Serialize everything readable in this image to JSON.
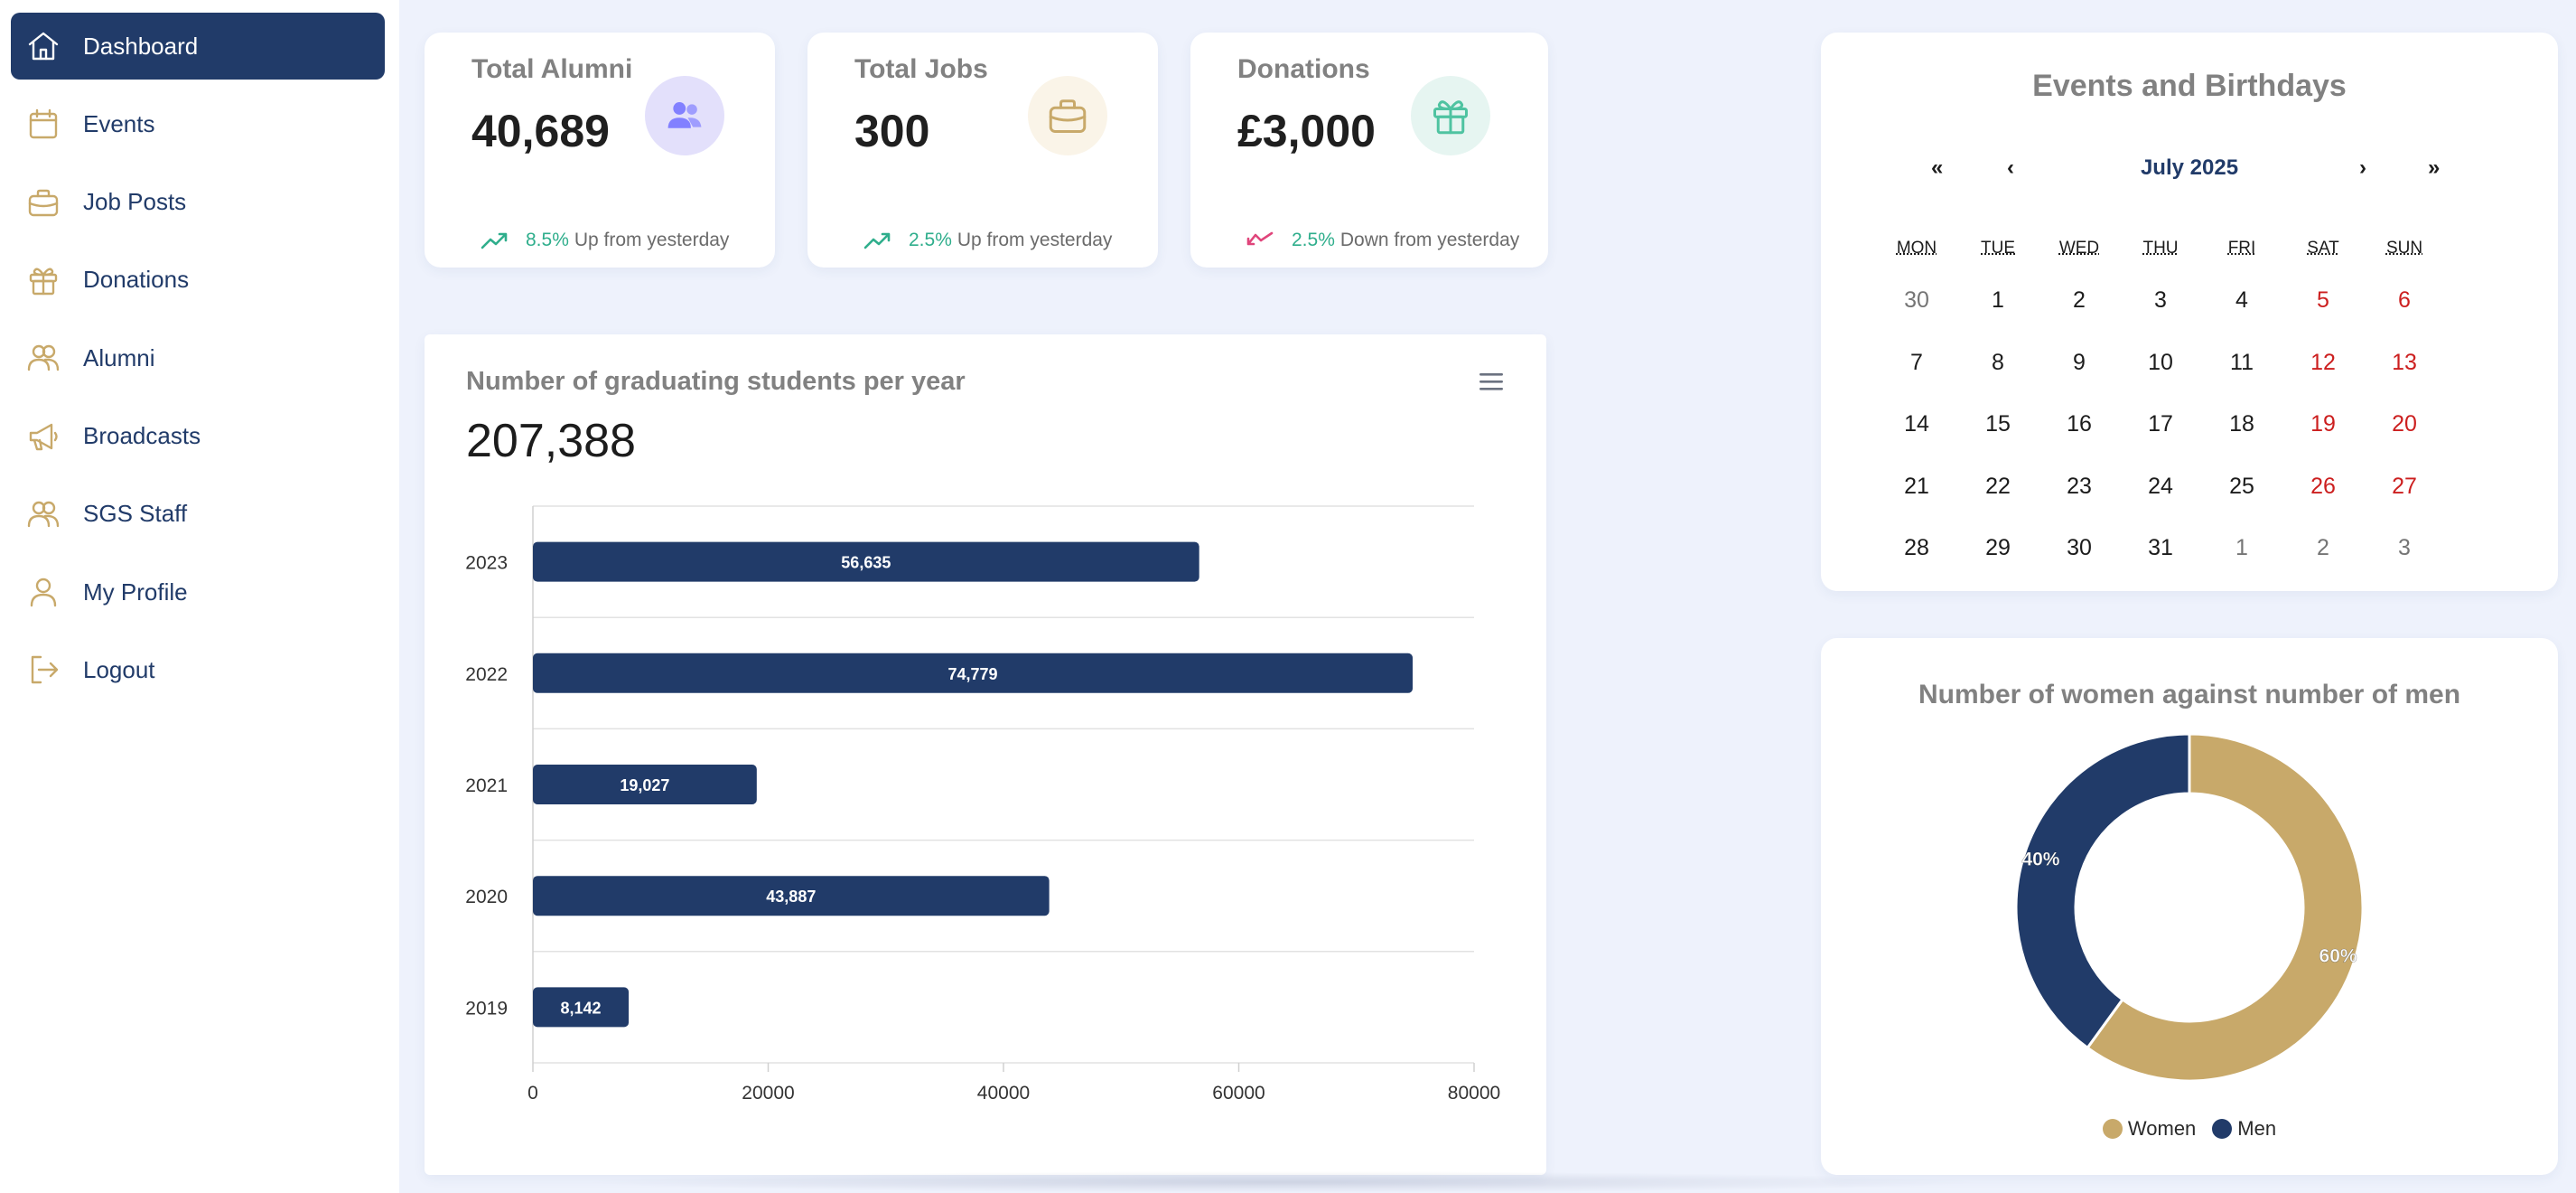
{
  "sidebar": {
    "items": [
      {
        "label": "Dashboard",
        "icon": "home-icon",
        "active": true
      },
      {
        "label": "Events",
        "icon": "calendar-icon"
      },
      {
        "label": "Job Posts",
        "icon": "briefcase-icon"
      },
      {
        "label": "Donations",
        "icon": "gift-icon"
      },
      {
        "label": "Alumni",
        "icon": "users-icon"
      },
      {
        "label": "Broadcasts",
        "icon": "megaphone-icon"
      },
      {
        "label": "SGS Staff",
        "icon": "users-icon"
      },
      {
        "label": "My Profile",
        "icon": "user-icon"
      },
      {
        "label": "Logout",
        "icon": "logout-icon"
      }
    ]
  },
  "stats": [
    {
      "title": "Total Alumni",
      "value": "40,689",
      "icon": "users-icon",
      "trend": "up",
      "pct": "8.5%",
      "text": "Up from yesterday"
    },
    {
      "title": "Total Jobs",
      "value": "300",
      "icon": "briefcase-icon",
      "trend": "up",
      "pct": "2.5%",
      "text": "Up from yesterday"
    },
    {
      "title": "Donations",
      "value": "£3,000",
      "icon": "gift-icon",
      "trend": "down",
      "pct": "2.5%",
      "text": "Down from yesterday"
    }
  ],
  "colors": {
    "navy": "#213b69",
    "gold": "#c8a96a",
    "up_green": "#2fae8c",
    "down_red": "#e0457b",
    "weekend_red": "#cc1f1f"
  },
  "chart_data": [
    {
      "type": "bar",
      "orientation": "horizontal",
      "title": "Number of graduating students per year",
      "total_label": "207,388",
      "categories": [
        "2023",
        "2022",
        "2021",
        "2020",
        "2019"
      ],
      "values": [
        56635,
        74779,
        19027,
        43887,
        8142
      ],
      "data_labels": [
        "56,635",
        "74,779",
        "19,027",
        "43,887",
        "8,142"
      ],
      "xlim": [
        0,
        80000
      ],
      "xticks": [
        "0",
        "20000",
        "40000",
        "60000",
        "80000"
      ],
      "grid": true,
      "color": "#213b69"
    },
    {
      "type": "pie",
      "variant": "donut",
      "title": "Number of women against number of men",
      "series": [
        {
          "name": "Women",
          "value": 60,
          "label": "60%",
          "color": "#c8a96a"
        },
        {
          "name": "Men",
          "value": 40,
          "label": "40%",
          "color": "#213b69"
        }
      ],
      "legend_position": "bottom"
    }
  ],
  "calendar": {
    "title": "Events and Birthdays",
    "month_label": "July 2025",
    "nav": {
      "prev_year": "«",
      "prev_month": "‹",
      "next_month": "›",
      "next_year": "»"
    },
    "weekdays": [
      "MON",
      "TUE",
      "WED",
      "THU",
      "FRI",
      "SAT",
      "SUN"
    ],
    "weeks": [
      [
        "30",
        "1",
        "2",
        "3",
        "4",
        "5",
        "6"
      ],
      [
        "7",
        "8",
        "9",
        "10",
        "11",
        "12",
        "13"
      ],
      [
        "14",
        "15",
        "16",
        "17",
        "18",
        "19",
        "20"
      ],
      [
        "21",
        "22",
        "23",
        "24",
        "25",
        "26",
        "27"
      ],
      [
        "28",
        "29",
        "30",
        "31",
        "1",
        "2",
        "3"
      ]
    ],
    "outside_month": [
      [
        0,
        0
      ],
      [
        4,
        4
      ],
      [
        4,
        5
      ],
      [
        4,
        6
      ]
    ]
  }
}
